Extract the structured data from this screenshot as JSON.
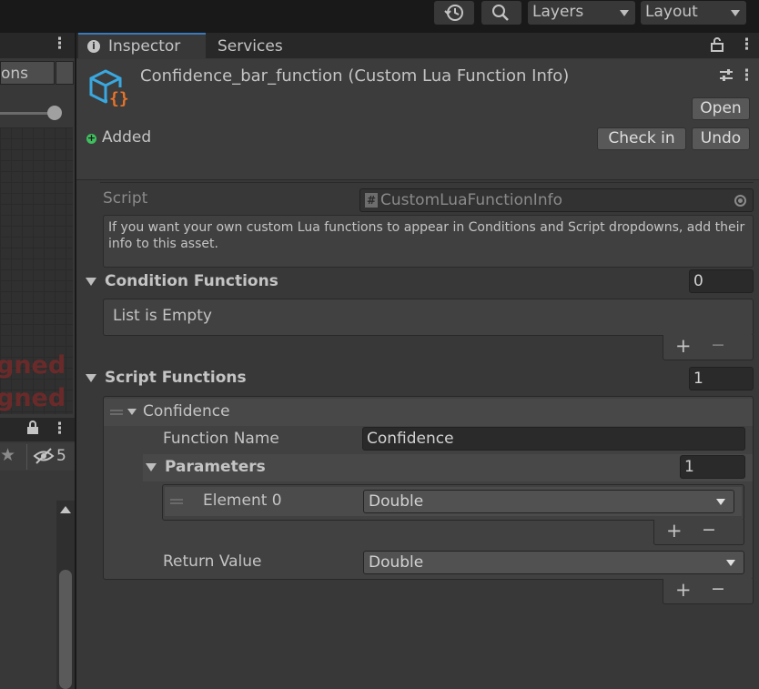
{
  "toolbar": {
    "layers_label": "Layers",
    "layout_label": "Layout"
  },
  "left_panel": {
    "tab_label": "ons",
    "red_text_1": "gned",
    "red_text_2": "gned",
    "eye_count": "5"
  },
  "tabs": {
    "inspector": "Inspector",
    "services": "Services"
  },
  "header": {
    "title": "Confidence_bar_function (Custom Lua Function Info)",
    "open_label": "Open",
    "status": "Added",
    "checkin_label": "Check in",
    "undo_label": "Undo"
  },
  "script": {
    "label": "Script",
    "value": "CustomLuaFunctionInfo"
  },
  "help_text": "If you want your own custom Lua functions to appear in Conditions and Script dropdowns, add their info to this asset.",
  "condition_functions": {
    "label": "Condition Functions",
    "count": "0",
    "empty_label": "List is Empty"
  },
  "script_functions": {
    "label": "Script Functions",
    "count": "1",
    "element": {
      "label": "Confidence",
      "function_name_label": "Function Name",
      "function_name_value": "Confidence",
      "parameters_label": "Parameters",
      "parameters_count": "1",
      "param_element_label": "Element 0",
      "param_element_value": "Double",
      "return_value_label": "Return Value",
      "return_value_value": "Double"
    }
  },
  "list_buttons": {
    "plus": "+",
    "minus": "−"
  },
  "colors": {
    "window_bg": "#383838",
    "toolbar_bg": "#191919",
    "status_green": "#3fbf5f",
    "icon_blue": "#3aa8e0",
    "icon_orange": "#e8742a",
    "red_text": "#6b2a2a"
  }
}
